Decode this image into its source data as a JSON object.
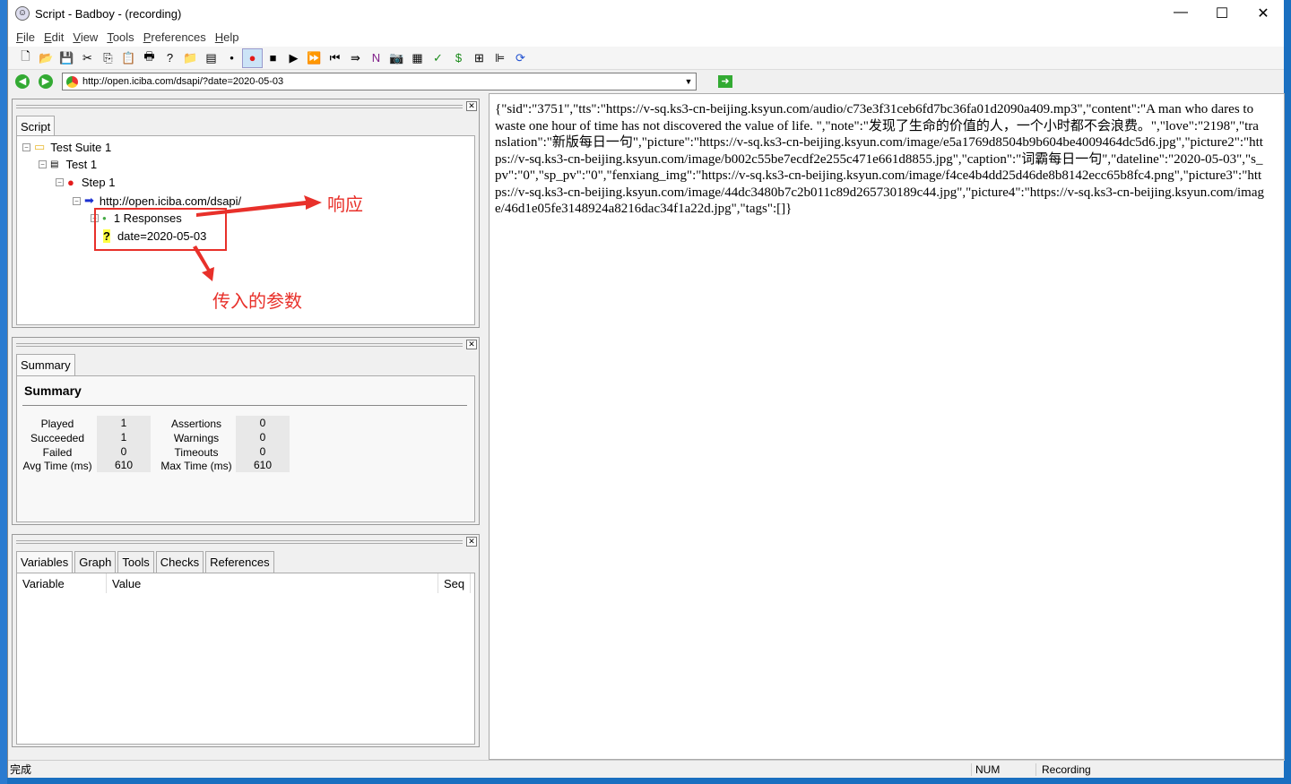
{
  "window": {
    "title": "Script - Badboy - (recording)",
    "minimize": "—",
    "maximize": "☐",
    "close": "✕"
  },
  "menu": [
    "File",
    "Edit",
    "View",
    "Tools",
    "Preferences",
    "Help"
  ],
  "toolbar": [
    {
      "icon": "new-icon",
      "glyph": "🗋"
    },
    {
      "icon": "open-icon",
      "glyph": "📂"
    },
    {
      "icon": "save-icon",
      "glyph": "💾"
    },
    {
      "icon": "cut-icon",
      "glyph": "✂"
    },
    {
      "icon": "copy-icon",
      "glyph": "⎘"
    },
    {
      "icon": "paste-icon",
      "glyph": "📋"
    },
    {
      "icon": "print-icon",
      "glyph": "🖶"
    },
    {
      "icon": "help-icon",
      "glyph": "?"
    },
    {
      "icon": "add-suite-icon",
      "glyph": "📁"
    },
    {
      "icon": "add-test-icon",
      "glyph": "▤"
    },
    {
      "icon": "add-step-icon",
      "glyph": "•"
    },
    {
      "icon": "record-icon",
      "glyph": "●"
    },
    {
      "icon": "stop-icon",
      "glyph": "■"
    },
    {
      "icon": "play-icon",
      "glyph": "▶"
    },
    {
      "icon": "play-all-icon",
      "glyph": "⏩"
    },
    {
      "icon": "rewind-icon",
      "glyph": "⏮"
    },
    {
      "icon": "step-icon",
      "glyph": "⇛"
    },
    {
      "icon": "n-icon",
      "glyph": "N"
    },
    {
      "icon": "camera-icon",
      "glyph": "📷"
    },
    {
      "icon": "report-icon",
      "glyph": "▦"
    },
    {
      "icon": "check-icon",
      "glyph": "✓"
    },
    {
      "icon": "dollar-icon",
      "glyph": "$"
    },
    {
      "icon": "table-icon",
      "glyph": "⊞"
    },
    {
      "icon": "chart-icon",
      "glyph": "⊫"
    },
    {
      "icon": "refresh-icon",
      "glyph": "⟳"
    }
  ],
  "address": {
    "url": "http://open.iciba.com/dsapi/?date=2020-05-03",
    "back": "◀",
    "forward": "▶",
    "go": "➜"
  },
  "script_panel": {
    "tab": "Script",
    "tree": [
      "Test Suite 1",
      "Test 1",
      "Step 1",
      "http://open.iciba.com/dsapi/",
      "1 Responses",
      "date=2020-05-03"
    ],
    "annotations": {
      "response": "响应",
      "params": "传入的参数"
    }
  },
  "summary_panel": {
    "tab": "Summary",
    "title": "Summary",
    "left": [
      {
        "label": "Played",
        "value": "1"
      },
      {
        "label": "Succeeded",
        "value": "1"
      },
      {
        "label": "Failed",
        "value": "0"
      },
      {
        "label": "Avg Time (ms)",
        "value": "610"
      }
    ],
    "right": [
      {
        "label": "Assertions",
        "value": "0"
      },
      {
        "label": "Warnings",
        "value": "0"
      },
      {
        "label": "Timeouts",
        "value": "0"
      },
      {
        "label": "Max Time (ms)",
        "value": "610"
      }
    ]
  },
  "variables_panel": {
    "tabs": [
      "Variables",
      "Graph",
      "Tools",
      "Checks",
      "References"
    ],
    "columns": [
      "Variable",
      "Value",
      "Seq"
    ]
  },
  "response": "{\"sid\":\"3751\",\"tts\":\"https://v-sq.ks3-cn-beijing.ksyun.com/audio/c73e3f31ceb6fd7bc36fa01d2090a409.mp3\",\"content\":\"A man who dares to waste one hour of time has not discovered the value of life. \",\"note\":\"发现了生命的价值的人，一个小时都不会浪费。\",\"love\":\"2198\",\"translation\":\"新版每日一句\",\"picture\":\"https://v-sq.ks3-cn-beijing.ksyun.com/image/e5a1769d8504b9b604be4009464dc5d6.jpg\",\"picture2\":\"https://v-sq.ks3-cn-beijing.ksyun.com/image/b002c55be7ecdf2e255c471e661d8855.jpg\",\"caption\":\"词霸每日一句\",\"dateline\":\"2020-05-03\",\"s_pv\":\"0\",\"sp_pv\":\"0\",\"fenxiang_img\":\"https://v-sq.ks3-cn-beijing.ksyun.com/image/f4ce4b4dd25d46de8b8142ecc65b8fc4.png\",\"picture3\":\"https://v-sq.ks3-cn-beijing.ksyun.com/image/44dc3480b7c2b011c89d265730189c44.jpg\",\"picture4\":\"https://v-sq.ks3-cn-beijing.ksyun.com/image/46d1e05fe3148924a8216dac34f1a22d.jpg\",\"tags\":[]}",
  "status": {
    "left": "完成",
    "num": "NUM",
    "mode": "Recording"
  },
  "colors": {
    "accent_red": "#e8302a",
    "record": "#e31b1b",
    "desktop": "#1a6fc0"
  }
}
